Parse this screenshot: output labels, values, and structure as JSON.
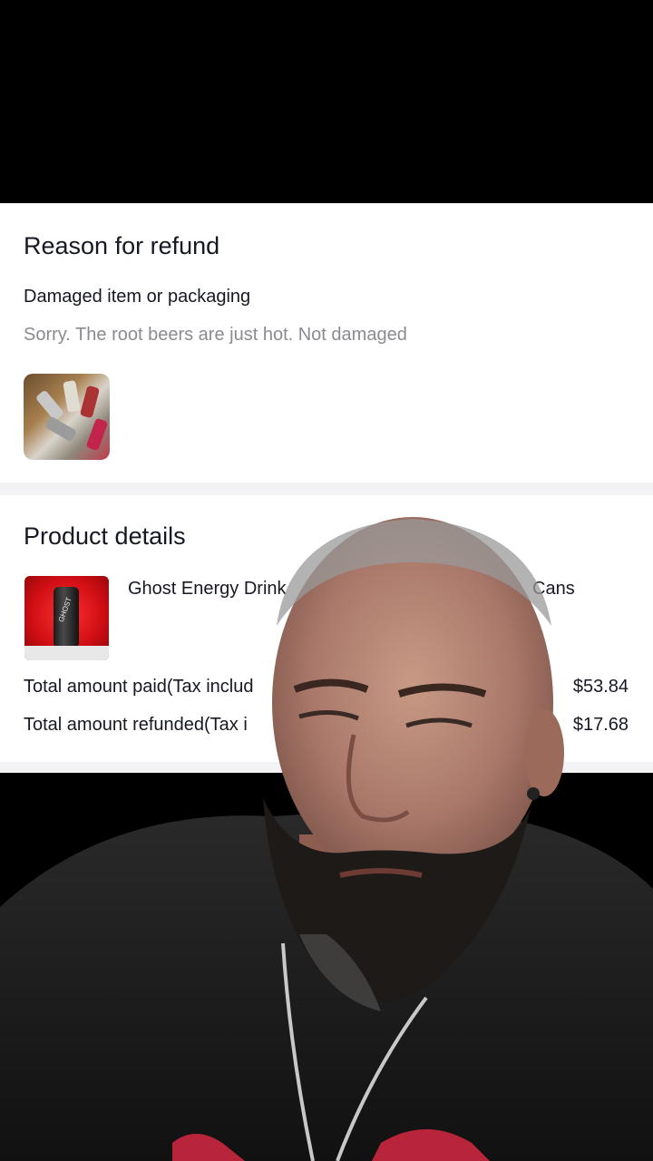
{
  "refund": {
    "title": "Reason for refund",
    "reason": "Damaged item or packaging",
    "comment": "Sorry. The root beers are just hot. Not damaged"
  },
  "product": {
    "title": "Product details",
    "name_start": "Ghost Energy Drink",
    "name_end": "Cans",
    "paid_label": "Total amount paid(Tax includ",
    "paid_value": "$53.84",
    "refunded_label": "Total amount refunded(Tax i",
    "refunded_value": "$17.68"
  }
}
